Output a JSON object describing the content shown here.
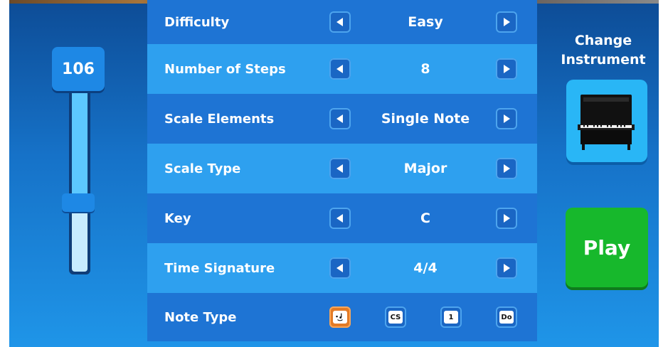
{
  "tempo": {
    "value": "106",
    "level": 0.62
  },
  "settings": [
    {
      "label": "Difficulty",
      "value": "Easy"
    },
    {
      "label": "Number of Steps",
      "value": "8"
    },
    {
      "label": "Scale Elements",
      "value": "Single Note"
    },
    {
      "label": "Scale Type",
      "value": "Major"
    },
    {
      "label": "Key",
      "value": "C"
    },
    {
      "label": "Time Signature",
      "value": "4/4"
    }
  ],
  "note_type": {
    "label": "Note Type",
    "options": [
      {
        "icon": "note-face-icon",
        "text": "",
        "selected": true
      },
      {
        "icon": "letter-note-icon",
        "text": "CS",
        "selected": false
      },
      {
        "icon": "number-note-icon",
        "text": "1",
        "selected": false
      },
      {
        "icon": "solfege-note-icon",
        "text": "Do",
        "selected": false
      }
    ]
  },
  "instrument": {
    "label": "Change Instrument",
    "icon": "upright-piano-icon"
  },
  "play": {
    "label": "Play"
  },
  "colors": {
    "row_dark": "#1e74d4",
    "row_light": "#2ea0ef",
    "play_green": "#17b82c",
    "selected_orange": "#e37b26"
  }
}
